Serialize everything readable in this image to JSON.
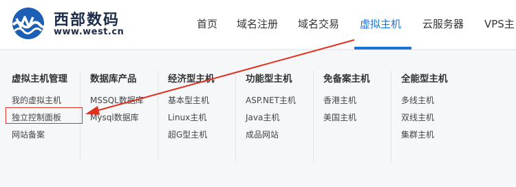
{
  "logo": {
    "name_cn": "西部数码",
    "url": "www.west.cn"
  },
  "nav": [
    {
      "label": "首页"
    },
    {
      "label": "域名注册"
    },
    {
      "label": "域名交易"
    },
    {
      "label": "虚拟主机",
      "active": true
    },
    {
      "label": "云服务器"
    },
    {
      "label": "VPS主"
    }
  ],
  "menu": {
    "columns": [
      {
        "title": "虚拟主机管理",
        "links": [
          "我的虚拟主机",
          "独立控制面板",
          "网站备案"
        ]
      },
      {
        "title": "数据库产品",
        "links": [
          "MSSQL数据库",
          "Mysql数据库"
        ]
      },
      {
        "title": "经济型主机",
        "links": [
          "基本型主机",
          "Linux主机",
          "超G型主机"
        ]
      },
      {
        "title": "功能型主机",
        "links": [
          "ASP.NET主机",
          "Java主机",
          "成品网站"
        ]
      },
      {
        "title": "免备案主机",
        "links": [
          "香港主机",
          "美国主机"
        ]
      },
      {
        "title": "全能型主机",
        "links": [
          "多线主机",
          "双线主机",
          "集群主机"
        ]
      }
    ]
  },
  "colors": {
    "accent": "#1a73d9",
    "annotation": "#e0301e",
    "brand_dark": "#1b2a48"
  }
}
